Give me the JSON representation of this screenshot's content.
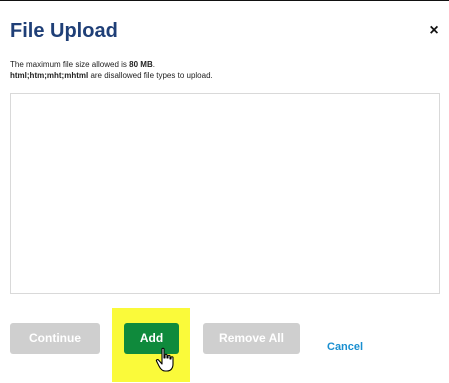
{
  "dialog": {
    "title": "File Upload",
    "close_symbol": "×",
    "info": {
      "line1_prefix": "The maximum file size allowed is ",
      "line1_size": "80 MB",
      "line1_suffix": ".",
      "line2_types": "html;htm;mht;mhtml",
      "line2_suffix": " are disallowed file types to upload."
    }
  },
  "buttons": {
    "continue_label": "Continue",
    "add_label": "Add",
    "remove_all_label": "Remove All",
    "cancel_label": "Cancel"
  },
  "icons": {
    "close": "close-icon",
    "cursor": "hand-pointer-icon"
  },
  "colors": {
    "title": "#1f3f77",
    "add_button": "#0f8a3c",
    "disabled_button": "#cfcfcf",
    "cancel_link": "#1a8fd0",
    "highlight": "#fafa3a"
  }
}
